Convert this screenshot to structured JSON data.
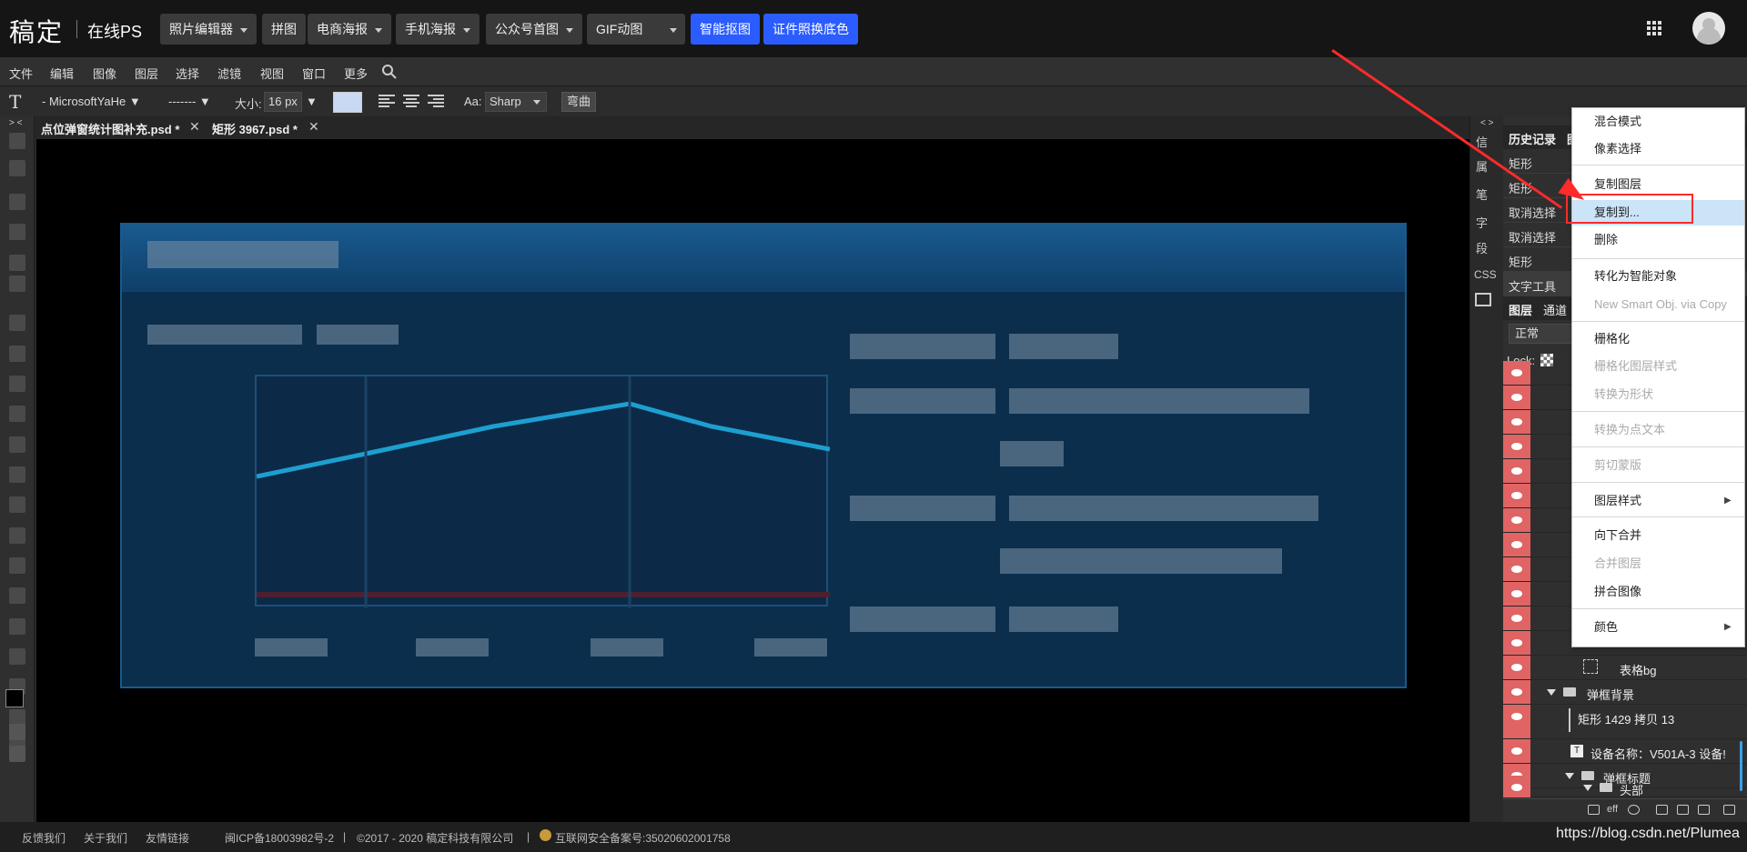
{
  "site": {
    "logo": "稿定",
    "logo_sub": "在线PS",
    "nav": [
      {
        "label": "照片编辑器",
        "dropdown": true
      },
      {
        "label": "拼图",
        "dropdown": false
      },
      {
        "label": "电商海报",
        "dropdown": true
      },
      {
        "label": "手机海报",
        "dropdown": true
      },
      {
        "label": "公众号首图",
        "dropdown": true
      },
      {
        "label": "GIF动图",
        "dropdown": true
      },
      {
        "label": "智能抠图",
        "dropdown": false,
        "accent": "#2b5cff"
      },
      {
        "label": "证件照换底色",
        "dropdown": false,
        "accent": "#2b5cff"
      }
    ]
  },
  "menubar": [
    "文件",
    "编辑",
    "图像",
    "图层",
    "选择",
    "滤镜",
    "视图",
    "窗口",
    "更多"
  ],
  "options": {
    "tool_icon": "T",
    "font_family": "- MicrosoftYaHe ▼",
    "font_style": "------- ▼",
    "size_label": "大小:",
    "size_value": "16 px",
    "size_caret": "▼",
    "antialias_label": "Aa:",
    "antialias_value": "Sharp",
    "warp_label": "弯曲",
    "text_color": "#c9d8f3"
  },
  "tabs": [
    {
      "label": "点位弹窗统计图补充.psd *",
      "close": "✕"
    },
    {
      "label": "矩形 3967.psd *",
      "close": "✕"
    }
  ],
  "strip": [
    "信",
    "属",
    "笔",
    "字",
    "段",
    "CSS"
  ],
  "history": {
    "tabs": [
      "历史记录",
      "图"
    ],
    "rows": [
      "矩形",
      "矩形",
      "取消选择",
      "取消选择",
      "矩形",
      "文字工具"
    ]
  },
  "layers": {
    "tabs": [
      "图层",
      "通道"
    ],
    "blend": "正常",
    "lock_label": "Lock:",
    "visible_rows": [
      {
        "name": "表格bg",
        "type": "layer"
      },
      {
        "name": "弹框背景",
        "type": "folder"
      },
      {
        "name": "矩形 1429 拷贝 13",
        "type": "layer"
      },
      {
        "name": "设备名称：V501A-3 设备!",
        "type": "text"
      },
      {
        "name": "弹框标题",
        "type": "folder"
      },
      {
        "name": "头部",
        "type": "folder"
      }
    ],
    "bottom_label": "eff"
  },
  "context_menu": {
    "items": [
      {
        "label": "混合模式",
        "disabled": false
      },
      {
        "label": "像素选择",
        "disabled": false
      },
      {
        "sep": true
      },
      {
        "label": "复制图层",
        "disabled": false
      },
      {
        "label": "复制到...",
        "disabled": false,
        "highlight": true
      },
      {
        "label": "删除",
        "disabled": false
      },
      {
        "sep": true
      },
      {
        "label": "转化为智能对象",
        "disabled": false
      },
      {
        "label": "New Smart Obj. via Copy",
        "disabled": true
      },
      {
        "sep": true
      },
      {
        "label": "栅格化",
        "disabled": false
      },
      {
        "label": "栅格化图层样式",
        "disabled": true
      },
      {
        "label": "转换为形状",
        "disabled": true
      },
      {
        "sep": true
      },
      {
        "label": "转换为点文本",
        "disabled": true
      },
      {
        "sep": true
      },
      {
        "label": "剪切蒙版",
        "disabled": true
      },
      {
        "sep": true
      },
      {
        "label": "图层样式",
        "disabled": false,
        "submenu": "▶"
      },
      {
        "sep": true
      },
      {
        "label": "向下合并",
        "disabled": false
      },
      {
        "label": "合并图层",
        "disabled": true
      },
      {
        "label": "拼合图像",
        "disabled": false
      },
      {
        "sep": true
      },
      {
        "label": "颜色",
        "disabled": false,
        "submenu": "▶"
      }
    ]
  },
  "footer": {
    "links": [
      "反馈我们",
      "关于我们",
      "友情链接"
    ],
    "icp": "闽ICP备18003982号-2",
    "copyright": "©2017 - 2020 稿定科技有限公司",
    "police": "互联网安全备案号:35020602001758",
    "watermark": "https://blog.csdn.net/Plumea"
  },
  "colors": {
    "accent": "#2b5cff",
    "annotation": "#ff2a2a",
    "highlight": "#cbe4f8",
    "eye": "#e06464"
  }
}
